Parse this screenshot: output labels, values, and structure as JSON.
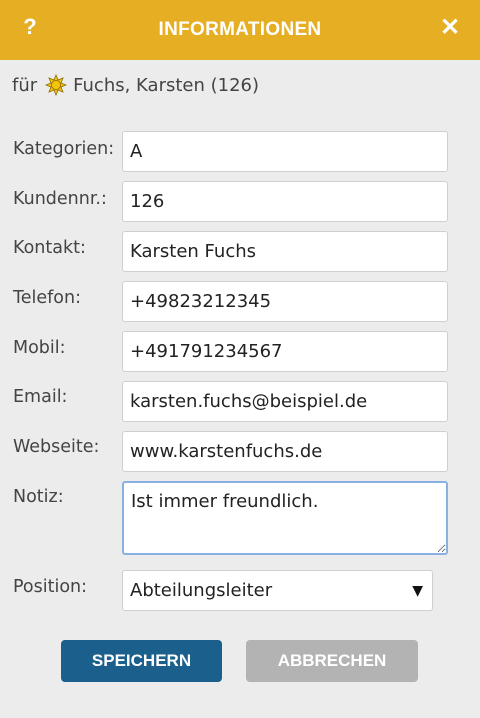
{
  "titlebar": {
    "help_label": "?",
    "title": "INFORMATIONEN",
    "close_label": "✕"
  },
  "customer": {
    "prefix": "für",
    "name": "Fuchs, Karsten (126)",
    "icon": "sun-icon",
    "icon_color": "#f2c40f"
  },
  "form": {
    "fields": [
      {
        "label": "Kategorien:",
        "value": "A"
      },
      {
        "label": "Kundennr.:",
        "value": "126"
      },
      {
        "label": "Kontakt:",
        "value": "Karsten Fuchs"
      },
      {
        "label": "Telefon:",
        "value": "+49823212345"
      },
      {
        "label": "Mobil:",
        "value": "+491791234567"
      },
      {
        "label": "Email:",
        "value": "karsten.fuchs@beispiel.de"
      },
      {
        "label": "Webseite:",
        "value": "www.karstenfuchs.de"
      }
    ],
    "notiz": {
      "label": "Notiz:",
      "value": "Ist immer freundlich."
    },
    "position": {
      "label": "Position:",
      "value": "Abteilungsleiter",
      "arrow": "▼"
    }
  },
  "buttons": {
    "save": "SPEICHERN",
    "cancel": "ABBRECHEN"
  },
  "colors": {
    "header": "#e6ae22",
    "save": "#1b5f8c",
    "cancel": "#b3b3b3"
  }
}
